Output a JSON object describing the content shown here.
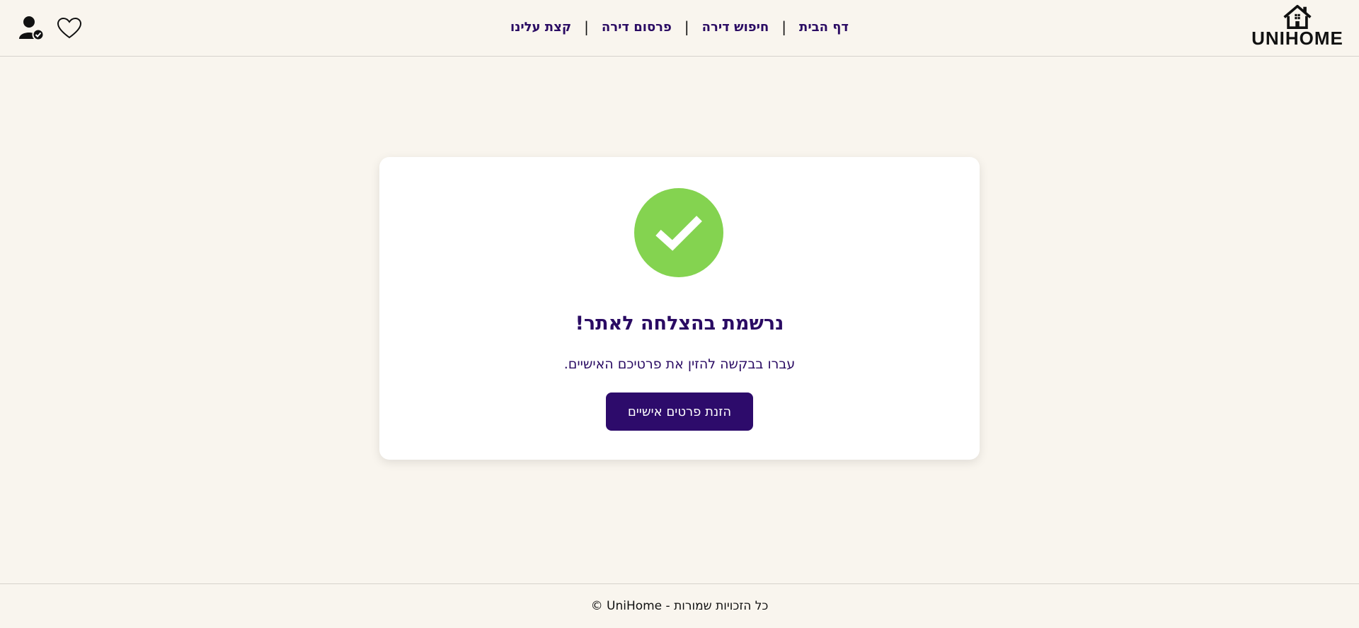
{
  "header": {
    "logo_text": "UNIHOME",
    "icons": [
      "user-check-icon",
      "heart-icon"
    ],
    "nav": [
      {
        "label": "דף הבית"
      },
      {
        "label": "חיפוש דירה"
      },
      {
        "label": "פרסום דירה"
      },
      {
        "label": "קצת עלינו"
      }
    ],
    "separator": "|"
  },
  "card": {
    "icon": "check-icon",
    "title": "נרשמת בהצלחה לאתר!",
    "text": "עברו בבקשה להזין את פרטיכם האישיים.",
    "button_label": "הזנת פרטים אישיים"
  },
  "footer": {
    "text": "© UniHome - כל הזכויות שמורות"
  },
  "colors": {
    "background": "#f9f5ee",
    "primary": "#2d0b6b",
    "success": "#84d350",
    "card": "#ffffff"
  }
}
